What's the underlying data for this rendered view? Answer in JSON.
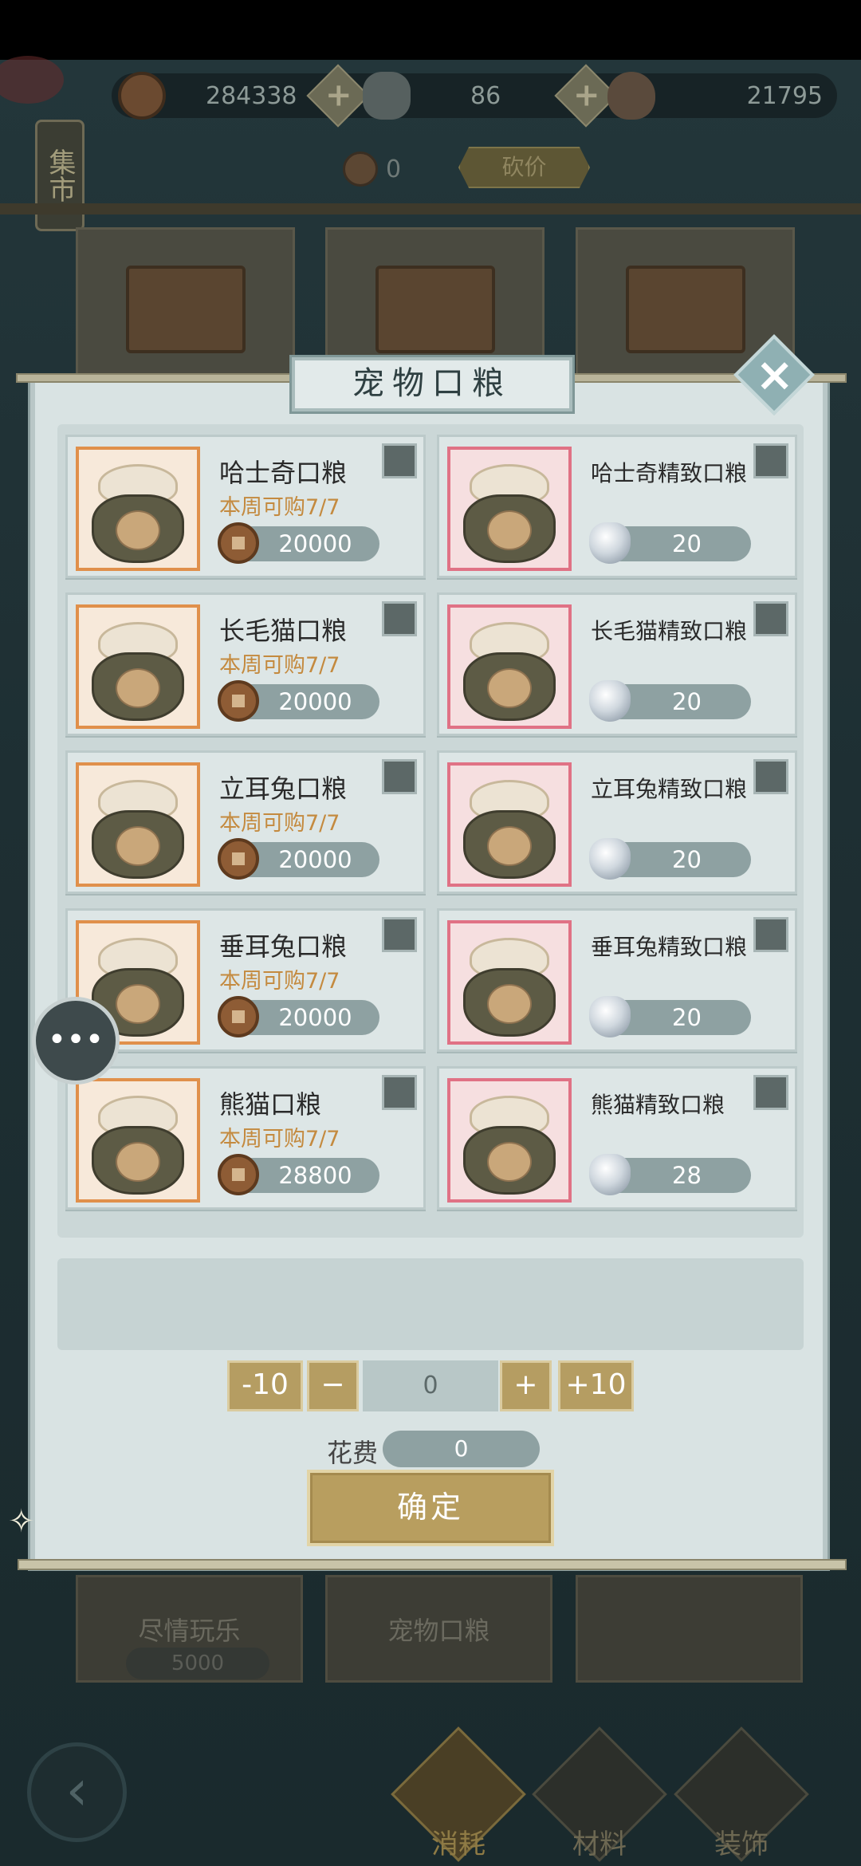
{
  "currencies": {
    "copper": {
      "value": "284338",
      "icon": "copper-coin-icon"
    },
    "silver": {
      "value": "86",
      "icon": "silver-ingot-icon"
    },
    "shell": {
      "value": "21795",
      "icon": "shell-icon"
    }
  },
  "market_sign": "集市",
  "token_count": "0",
  "bargain_label": "砍价",
  "modal": {
    "title": "宠物口粮",
    "close_icon": "close-icon"
  },
  "items": [
    {
      "name": "哈士奇口粮",
      "limit": "本周可购7/7",
      "price": "20000",
      "currency": "copper"
    },
    {
      "name": "哈士奇精致口粮",
      "limit": "",
      "price": "20",
      "currency": "silver"
    },
    {
      "name": "长毛猫口粮",
      "limit": "本周可购7/7",
      "price": "20000",
      "currency": "copper"
    },
    {
      "name": "长毛猫精致口粮",
      "limit": "",
      "price": "20",
      "currency": "silver"
    },
    {
      "name": "立耳兔口粮",
      "limit": "本周可购7/7",
      "price": "20000",
      "currency": "copper"
    },
    {
      "name": "立耳兔精致口粮",
      "limit": "",
      "price": "20",
      "currency": "silver"
    },
    {
      "name": "垂耳兔口粮",
      "limit": "本周可购7/7",
      "price": "20000",
      "currency": "copper"
    },
    {
      "name": "垂耳兔精致口粮",
      "limit": "",
      "price": "20",
      "currency": "silver"
    },
    {
      "name": "熊猫口粮",
      "limit": "本周可购7/7",
      "price": "28800",
      "currency": "copper"
    },
    {
      "name": "熊猫精致口粮",
      "limit": "",
      "price": "28",
      "currency": "silver"
    }
  ],
  "quantity": {
    "minus10": "-10",
    "minus": "−",
    "value": "0",
    "plus": "+",
    "plus10": "+10"
  },
  "cost": {
    "label": "花费",
    "value": "0"
  },
  "confirm_label": "确定",
  "shelf_bottom": [
    {
      "label": "尽情玩乐",
      "price": "5000"
    },
    {
      "label": "宠物口粮",
      "price": ""
    },
    {
      "label": "",
      "price": ""
    }
  ],
  "bottom_tabs": [
    {
      "label": "消耗",
      "active": true
    },
    {
      "label": "材料",
      "active": false
    },
    {
      "label": "装饰",
      "active": false
    }
  ],
  "colors": {
    "modal_bg": "#d9e3e3",
    "accent_gold": "#b89e5f",
    "limit_text": "#c48a3f",
    "normal_frame": "#e0904b",
    "premium_frame": "#e07285"
  }
}
